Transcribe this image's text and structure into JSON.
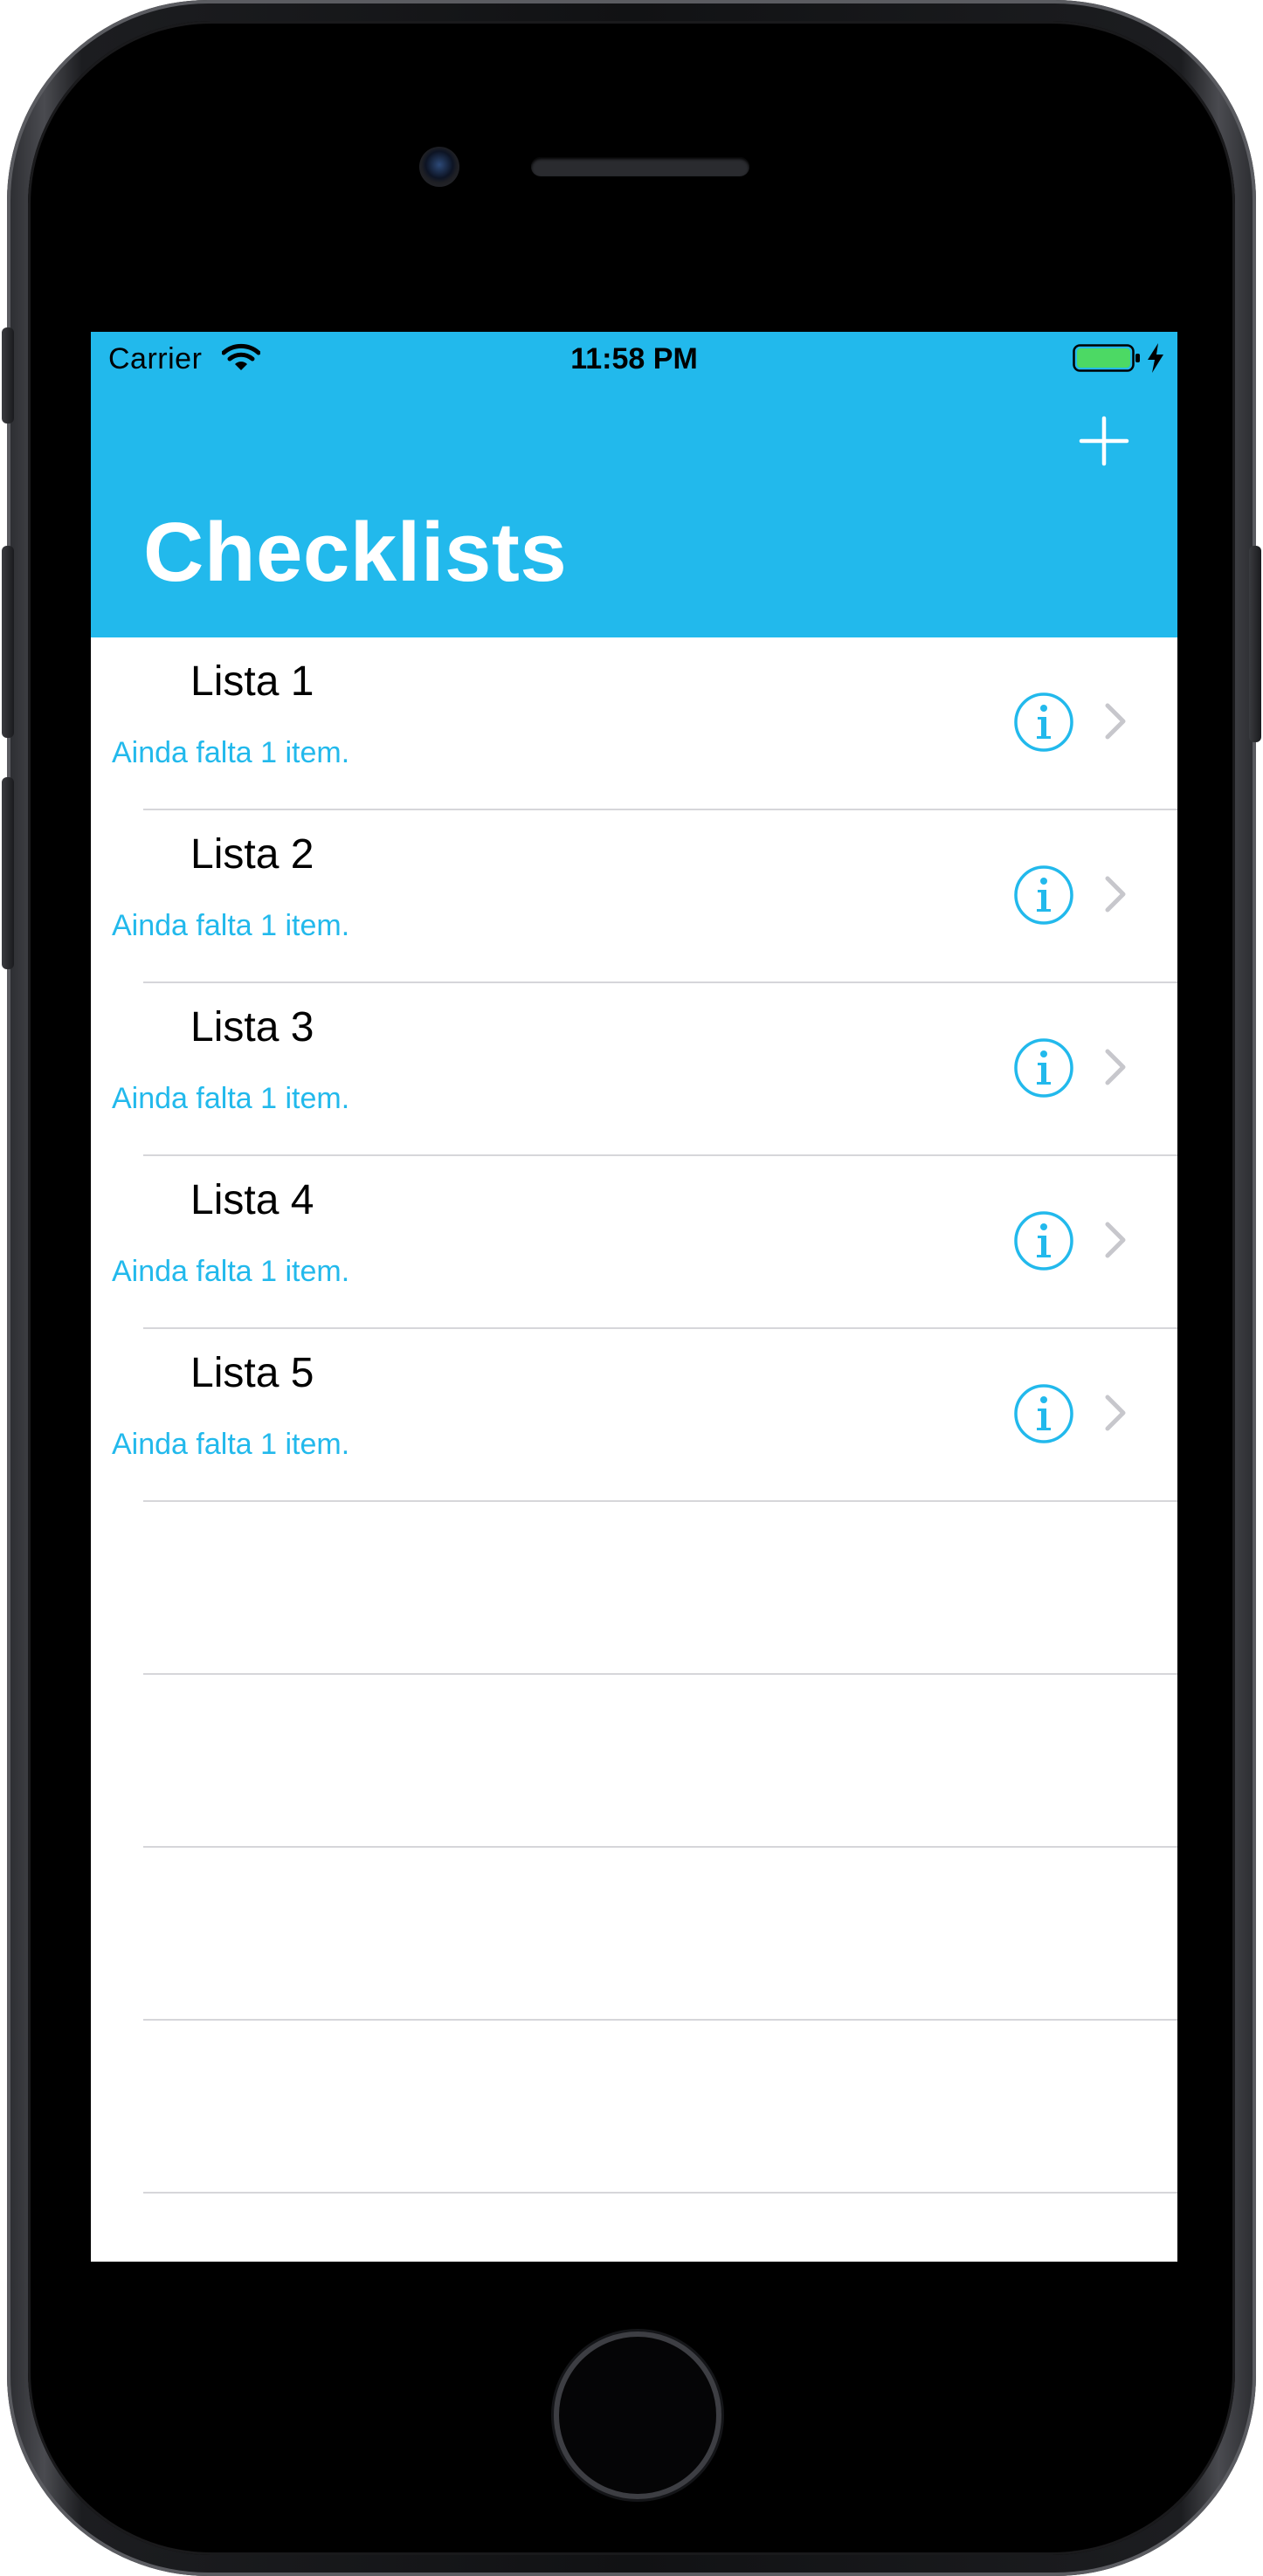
{
  "status_bar": {
    "carrier": "Carrier",
    "time": "11:58 PM",
    "icons": [
      "wifi-icon",
      "battery-icon",
      "charging-bolt-icon"
    ]
  },
  "nav": {
    "title": "Checklists",
    "add_icon": "plus-icon"
  },
  "list": {
    "items": [
      {
        "title": "Lista 1",
        "subtitle": "Ainda falta 1 item."
      },
      {
        "title": "Lista 2",
        "subtitle": "Ainda falta 1 item."
      },
      {
        "title": "Lista 3",
        "subtitle": "Ainda falta 1 item."
      },
      {
        "title": "Lista 4",
        "subtitle": "Ainda falta 1 item."
      },
      {
        "title": "Lista 5",
        "subtitle": "Ainda falta 1 item."
      }
    ],
    "row_icons": [
      "info-icon",
      "chevron-right-icon"
    ]
  },
  "colors": {
    "accent": "#22b9ec",
    "nav_background": "#22b9ec",
    "battery_fill": "#4cd964",
    "separator": "#d6d6da",
    "chevron": "#c7c7cc"
  }
}
